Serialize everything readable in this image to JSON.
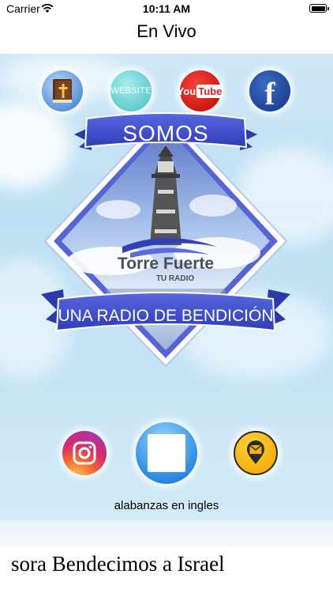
{
  "status_bar": {
    "carrier": "Carrier",
    "time": "10:11 AM"
  },
  "nav": {
    "title": "En Vivo"
  },
  "social": {
    "bible_icon": "bible-icon",
    "website_label": "WEBSITE",
    "youtube_you": "You",
    "youtube_tube": "Tube",
    "facebook_letter": "f"
  },
  "logo": {
    "top_banner": "SOMOS",
    "name": "Torre Fuerte",
    "tagline": "TU RADIO",
    "bottom_banner": "UNA RADIO DE BENDICIÓN"
  },
  "player": {
    "track_title": "alabanzas en ingles",
    "ticker": "sora Bendecimos a Israel"
  },
  "colors": {
    "sky": "#c6e4f5",
    "banner_blue": "#3f4fcf",
    "youtube_red": "#d9201a",
    "facebook_blue": "#2a52a8",
    "contact_yellow": "#f6b300"
  }
}
